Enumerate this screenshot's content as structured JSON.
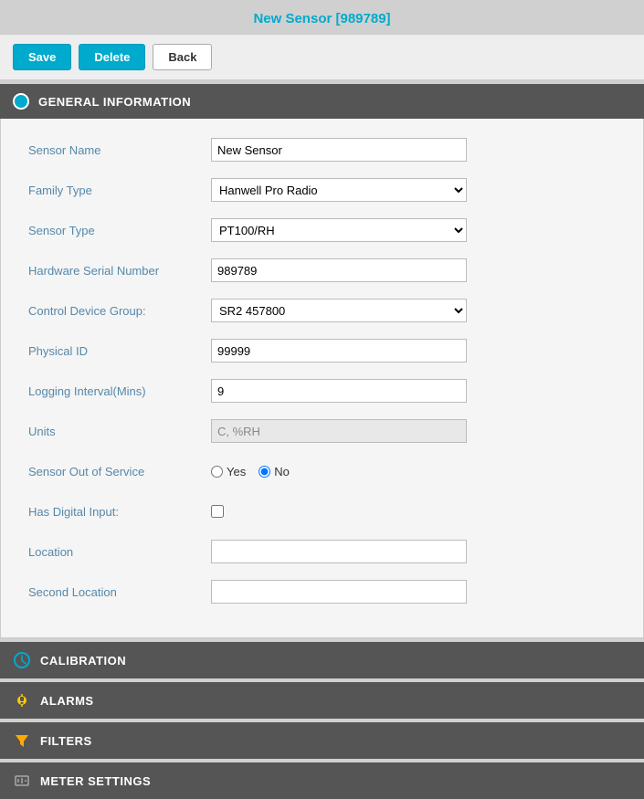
{
  "page": {
    "title": "New Sensor [989789]"
  },
  "toolbar": {
    "save_label": "Save",
    "delete_label": "Delete",
    "back_label": "Back"
  },
  "general_section": {
    "header": "GENERAL INFORMATION",
    "fields": {
      "sensor_name_label": "Sensor Name",
      "sensor_name_value": "New Sensor",
      "family_type_label": "Family Type",
      "family_type_value": "Hanwell Pro Radio",
      "sensor_type_label": "Sensor Type",
      "sensor_type_value": "PT100/RH",
      "hardware_serial_label": "Hardware Serial Number",
      "hardware_serial_value": "989789",
      "control_device_label": "Control Device Group:",
      "control_device_value": "SR2 457800",
      "physical_id_label": "Physical ID",
      "physical_id_value": "99999",
      "logging_interval_label": "Logging Interval(Mins)",
      "logging_interval_value": "9",
      "units_label": "Units",
      "units_value": "C, %RH",
      "out_of_service_label": "Sensor Out of Service",
      "out_of_service_yes": "Yes",
      "out_of_service_no": "No",
      "digital_input_label": "Has Digital Input:",
      "location_label": "Location",
      "location_value": "",
      "second_location_label": "Second Location",
      "second_location_value": ""
    }
  },
  "sections": {
    "calibration_label": "CALIBRATION",
    "alarms_label": "ALARMS",
    "filters_label": "FILTERS",
    "meter_settings_label": "METER SETTINGS"
  },
  "dropdowns": {
    "family_type_options": [
      "Hanwell Pro Radio"
    ],
    "sensor_type_options": [
      "PT100/RH"
    ],
    "control_device_options": [
      "SR2 457800"
    ]
  }
}
